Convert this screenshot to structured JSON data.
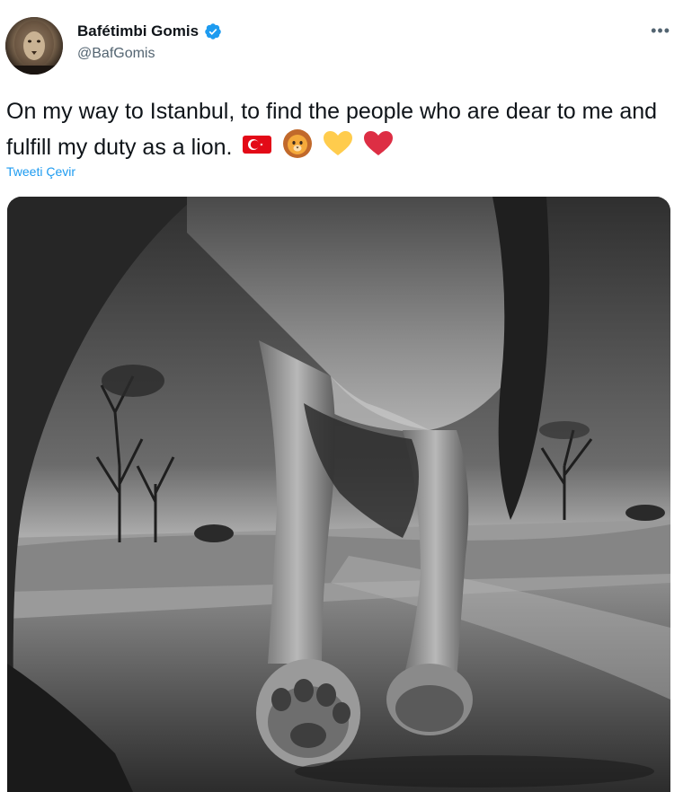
{
  "author": {
    "name": "Bafétimbi Gomis",
    "handle": "@BafGomis",
    "verified": true
  },
  "more_menu_label": "•••",
  "tweet": {
    "text": "On my way to Istanbul, to find the people who are dear to me and fulfill my duty as a lion.",
    "emojis": [
      "turkey-flag-emoji",
      "lion-face-emoji",
      "yellow-heart-emoji",
      "red-heart-emoji"
    ]
  },
  "translate_label": "Tweeti Çevir",
  "colors": {
    "accent": "#1d9bf0",
    "text_primary": "#0f1419",
    "text_secondary": "#536471",
    "verified_badge": "#1d9bf0",
    "heart_red": "#e0245e",
    "heart_yellow": "#ffcc4d",
    "flag_red": "#e30a17"
  }
}
